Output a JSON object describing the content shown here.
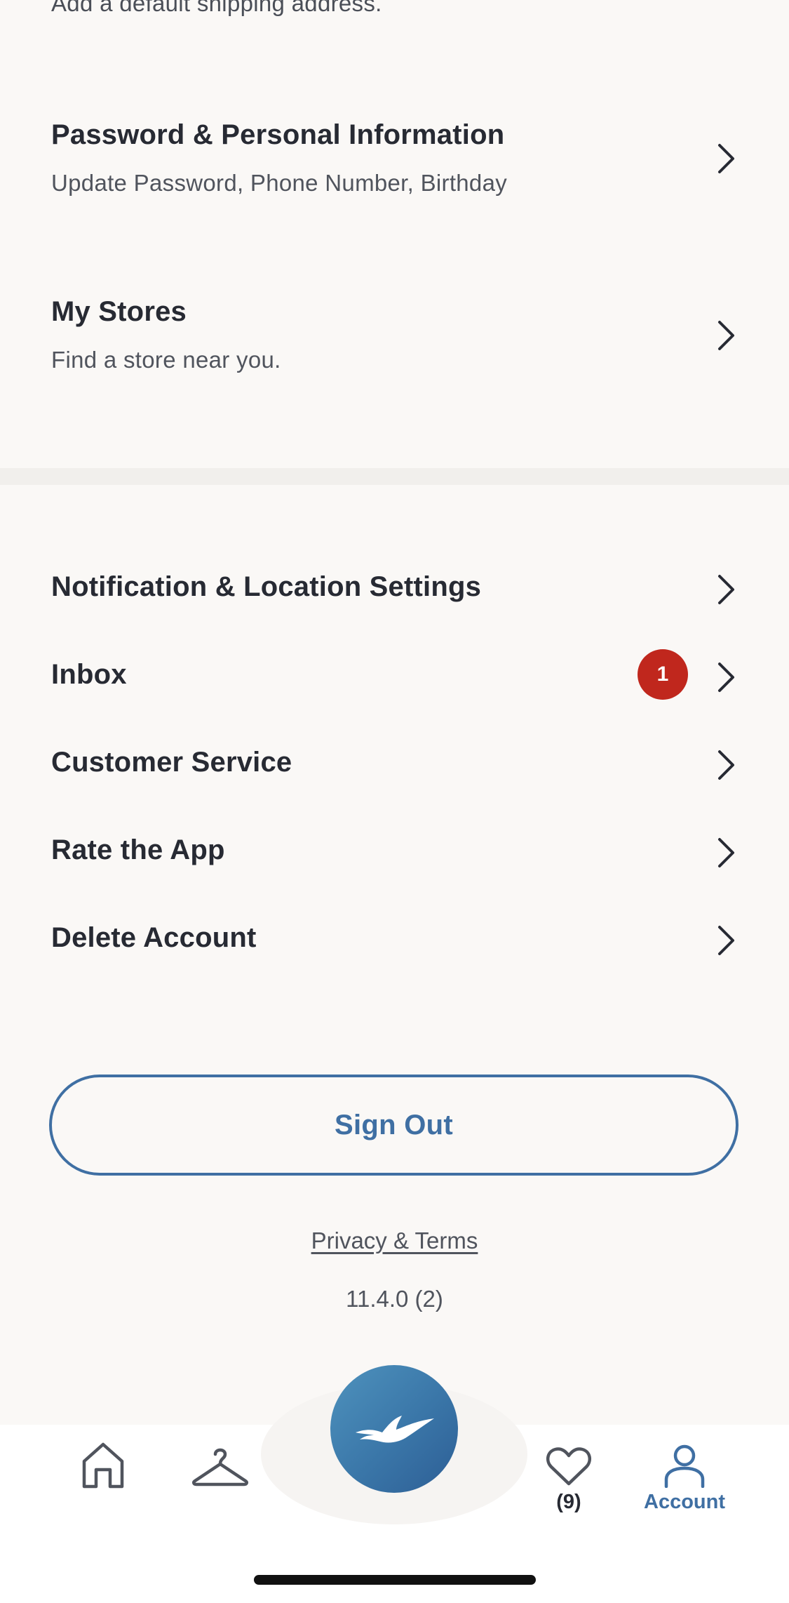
{
  "top_partial_text": "Add a default shipping address.",
  "account_rows": [
    {
      "title": "Password & Personal Information",
      "subtitle": "Update Password, Phone Number, Birthday"
    },
    {
      "title": "My Stores",
      "subtitle": "Find a store near you."
    }
  ],
  "settings_rows": [
    {
      "title": "Notification & Location Settings"
    },
    {
      "title": "Inbox",
      "badge": "1"
    },
    {
      "title": "Customer Service"
    },
    {
      "title": "Rate the App"
    },
    {
      "title": "Delete Account"
    }
  ],
  "sign_out_label": "Sign Out",
  "privacy_link": "Privacy & Terms",
  "version": "11.4.0 (2)",
  "tab_bar": {
    "home_icon": "home-icon",
    "shop_icon": "hanger-icon",
    "center_icon": "seagull-icon",
    "wishlist_icon": "heart-icon",
    "wishlist_count": "(9)",
    "account_icon": "person-icon",
    "account_label": "Account"
  },
  "colors": {
    "background": "#faf8f6",
    "accent": "#3f6fa3",
    "badge": "#c0271d",
    "text": "#272a33"
  }
}
